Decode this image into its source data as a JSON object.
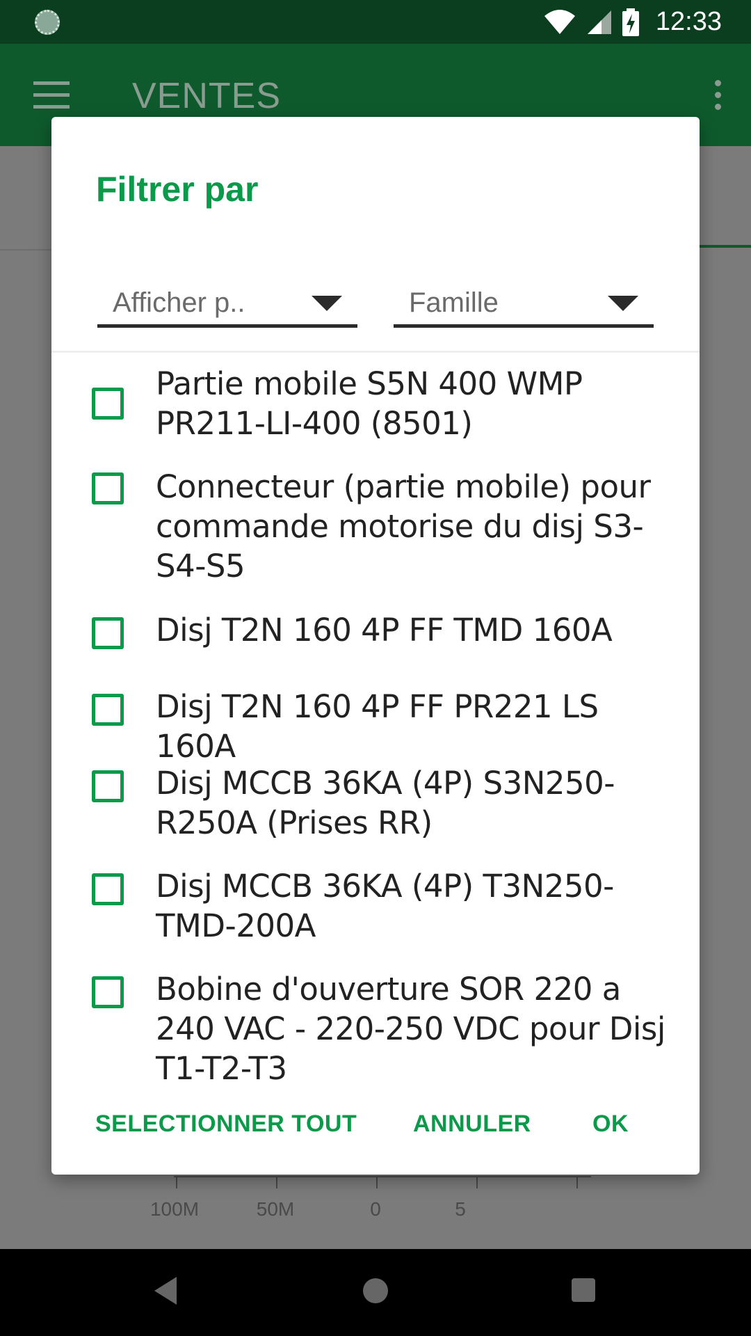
{
  "status_bar": {
    "time": "12:33"
  },
  "app_bar": {
    "title": "VENTES"
  },
  "background": {
    "axis_labels": [
      "100M",
      "50M",
      "0",
      "5"
    ]
  },
  "dialog": {
    "title": "Filtrer par",
    "spinners": [
      {
        "value": "Afficher p.."
      },
      {
        "value": "Famille"
      }
    ],
    "items": [
      {
        "label": "Partie mobile S5N 400 WMP PR211-LI-400 (8501)",
        "checked": false
      },
      {
        "label": "Connecteur (partie mobile) pour commande motorise du disj S3-S4-S5",
        "checked": false
      },
      {
        "label": "Disj T2N 160 4P FF TMD 160A",
        "checked": false
      },
      {
        "label": "Disj T2N 160 4P FF PR221 LS 160A",
        "checked": false
      },
      {
        "label": "Disj MCCB 36KA (4P) S3N250-R250A (Prises RR)",
        "checked": false
      },
      {
        "label": "Disj MCCB 36KA (4P) T3N250-TMD-200A",
        "checked": false
      },
      {
        "label": "Bobine d'ouverture SOR 220 a 240 VAC - 220-250  VDC pour Disj T1-T2-T3",
        "checked": false
      }
    ],
    "actions": {
      "select_all": "SELECTIONNER TOUT",
      "cancel": "ANNULER",
      "ok": "OK"
    }
  },
  "colors": {
    "accent": "#0a9a4a",
    "app_bar": "#0e5a2d",
    "status_bar": "#0a3e1f"
  }
}
